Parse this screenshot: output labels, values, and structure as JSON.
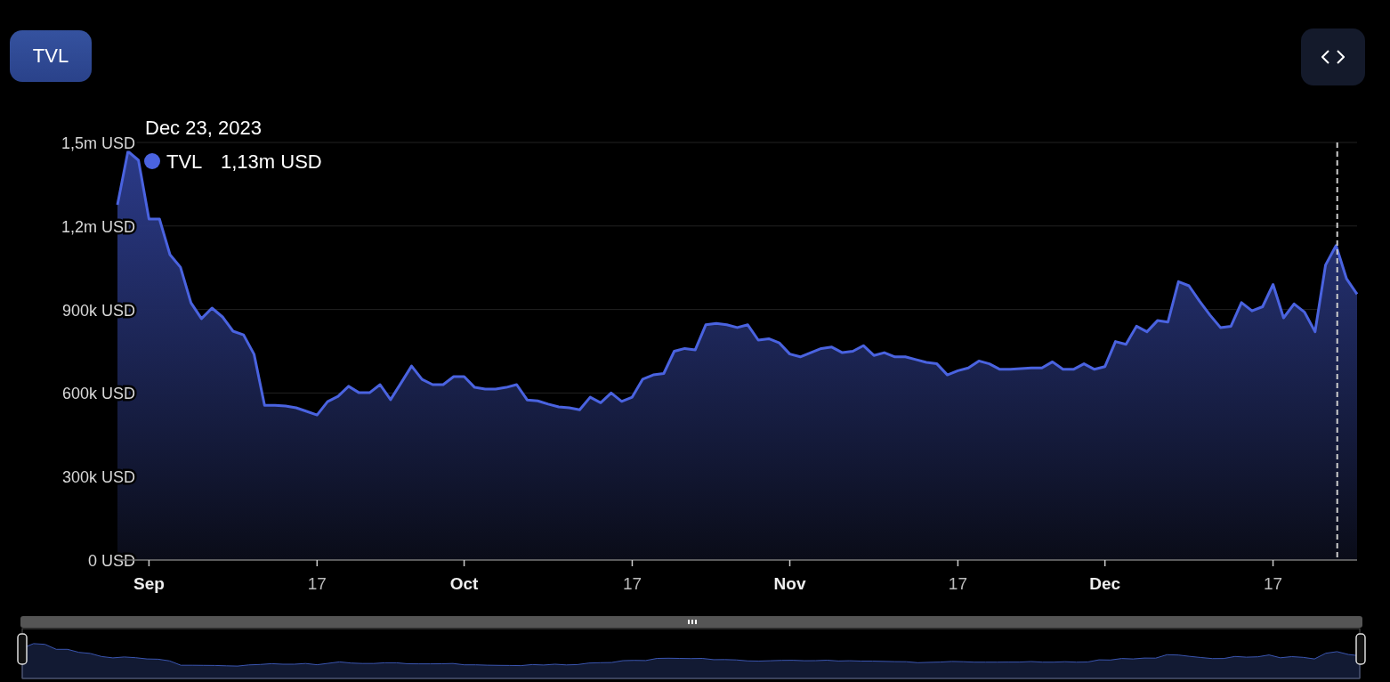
{
  "tabs": [
    {
      "label": "TVL",
      "selected": true
    }
  ],
  "tooltip": {
    "value": "1,13m USD",
    "level": 0.984
  },
  "chart_data": {
    "type": "area",
    "grid": true,
    "ylim": [
      0,
      1500000
    ],
    "categories": [
      null,
      null,
      null,
      "Sep",
      null,
      null,
      null,
      null,
      null,
      null,
      null,
      null,
      null,
      null,
      null,
      null,
      null,
      null,
      null,
      "17",
      null,
      null,
      null,
      null,
      null,
      null,
      null,
      null,
      null,
      null,
      null,
      null,
      null,
      "Oct",
      null,
      null,
      null,
      null,
      null,
      null,
      null,
      null,
      null,
      null,
      null,
      null,
      null,
      null,
      null,
      "17",
      null,
      null,
      null,
      null,
      null,
      null,
      null,
      null,
      null,
      null,
      null,
      null,
      null,
      null,
      "Nov",
      null,
      null,
      null,
      null,
      null,
      null,
      null,
      null,
      null,
      null,
      null,
      null,
      null,
      null,
      null,
      "17",
      null,
      null,
      null,
      null,
      null,
      null,
      null,
      null,
      null,
      null,
      null,
      null,
      null,
      "Dec",
      null,
      null,
      null,
      null,
      null,
      null,
      null,
      null,
      null,
      null,
      null,
      null,
      null,
      null,
      null,
      "17",
      null,
      null,
      null,
      null,
      null,
      null,
      null,
      null
    ],
    "series": [
      {
        "name": "TVL",
        "color": "#4a63e0",
        "values": [
          1276000,
          1468000,
          1436000,
          1225000,
          1225000,
          1097000,
          1052000,
          924000,
          867000,
          905000,
          873000,
          822000,
          809000,
          739000,
          556000,
          556000,
          553000,
          547000,
          534000,
          521000,
          569000,
          588000,
          624000,
          601000,
          601000,
          630000,
          576000,
          636000,
          697000,
          649000,
          630000,
          630000,
          659000,
          659000,
          620000,
          614000,
          614000,
          620000,
          630000,
          575000,
          572000,
          560000,
          550000,
          547000,
          540000,
          585000,
          565000,
          600000,
          570000,
          585000,
          650000,
          665000,
          670000,
          750000,
          760000,
          755000,
          845000,
          850000,
          845000,
          835000,
          845000,
          790000,
          795000,
          780000,
          740000,
          730000,
          745000,
          760000,
          765000,
          745000,
          750000,
          770000,
          735000,
          745000,
          730000,
          730000,
          720000,
          710000,
          705000,
          665000,
          680000,
          690000,
          715000,
          705000,
          685000,
          685000,
          688000,
          690000,
          690000,
          712000,
          685000,
          685000,
          705000,
          685000,
          695000,
          785000,
          775000,
          840000,
          820000,
          860000,
          855000,
          1000000,
          985000,
          930000,
          880000,
          835000,
          840000,
          925000,
          895000,
          910000,
          990000,
          870000,
          920000,
          890000,
          820000,
          1060000,
          1130000,
          1010000,
          955000
        ]
      }
    ],
    "yticks": [
      {
        "value": 0,
        "label": "0 USD"
      },
      {
        "value": 300000,
        "label": "300k USD"
      },
      {
        "value": 600000,
        "label": "600k USD"
      },
      {
        "value": 900000,
        "label": "900k USD"
      },
      {
        "value": 1200000,
        "label": "1,2m USD"
      },
      {
        "value": 1500000,
        "label": "1,5m USD"
      }
    ],
    "annotations": [
      "Dec 23, 2023"
    ]
  }
}
